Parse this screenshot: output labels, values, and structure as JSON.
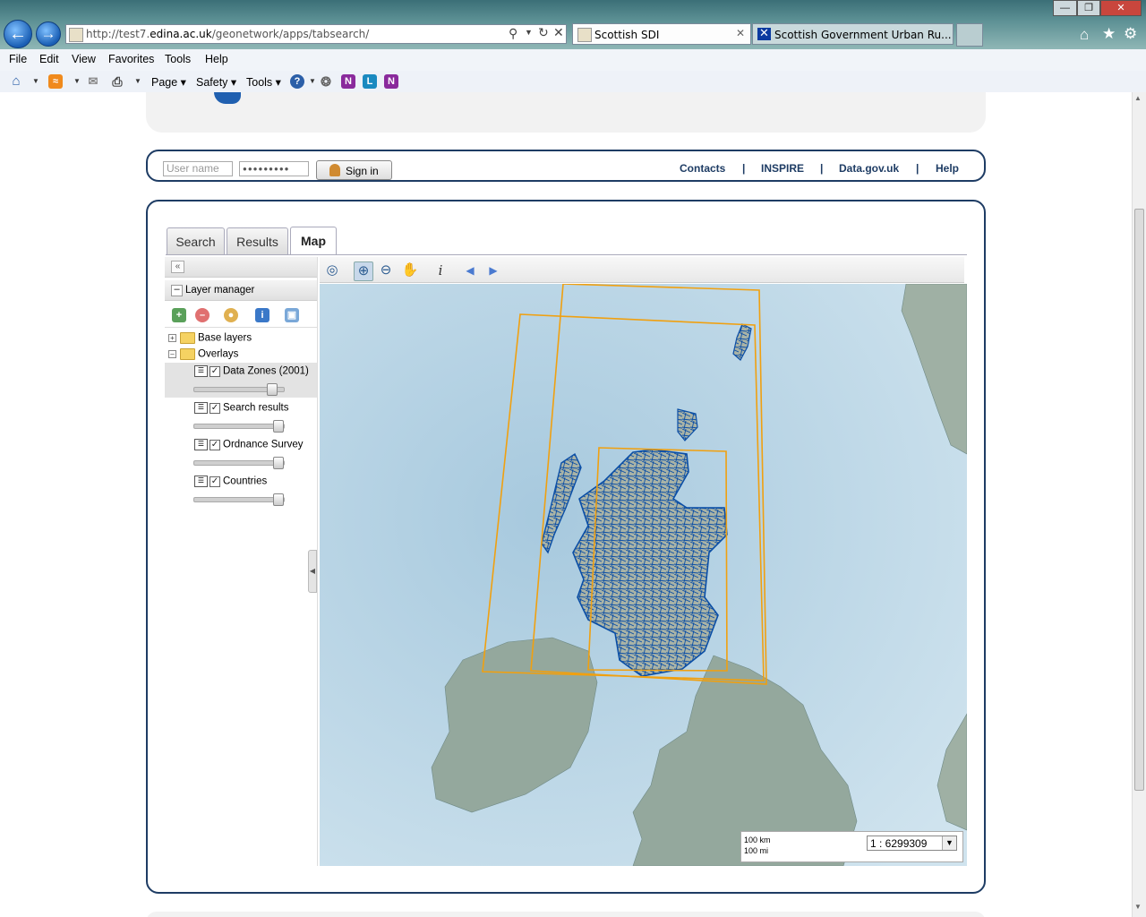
{
  "browser": {
    "url_prefix": "http://test7.",
    "url_domain": "edina.ac.uk",
    "url_path": "/geonetwork/apps/tabsearch/",
    "tabs": [
      {
        "label": "Scottish SDI"
      },
      {
        "label": "Scottish Government Urban Ru..."
      }
    ],
    "menu": [
      "File",
      "Edit",
      "View",
      "Favorites",
      "Tools",
      "Help"
    ],
    "commands": {
      "page": "Page",
      "safety": "Safety",
      "tools": "Tools"
    }
  },
  "login": {
    "username_placeholder": "User name",
    "password_mask": "●●●●●●●●●",
    "signin_label": "Sign in"
  },
  "top_links": [
    "Contacts",
    "|",
    "INSPIRE",
    "|",
    "Data.gov.uk",
    "|",
    "Help"
  ],
  "tabs": {
    "search": "Search",
    "results": "Results",
    "map": "Map"
  },
  "layer_manager": {
    "title": "Layer manager",
    "collapse_symbol": "«",
    "groups": {
      "base": "Base layers",
      "overlays": "Overlays"
    },
    "layers": [
      {
        "name": "Data Zones (2001)",
        "checked": true,
        "opacity": 0.92
      },
      {
        "name": "Search results",
        "checked": true,
        "opacity": 1.0
      },
      {
        "name": "Ordnance Survey",
        "checked": true,
        "opacity": 1.0
      },
      {
        "name": "Countries",
        "checked": true,
        "opacity": 1.0
      }
    ]
  },
  "map": {
    "scale_km": "100 km",
    "scale_mi": "100 mi",
    "scale_value": "1 : 6299309"
  },
  "colors": {
    "accent": "#1e3c64",
    "bbox": "#f0a010",
    "zones": "#0a4ea6",
    "sea": "#b9d7e6"
  }
}
